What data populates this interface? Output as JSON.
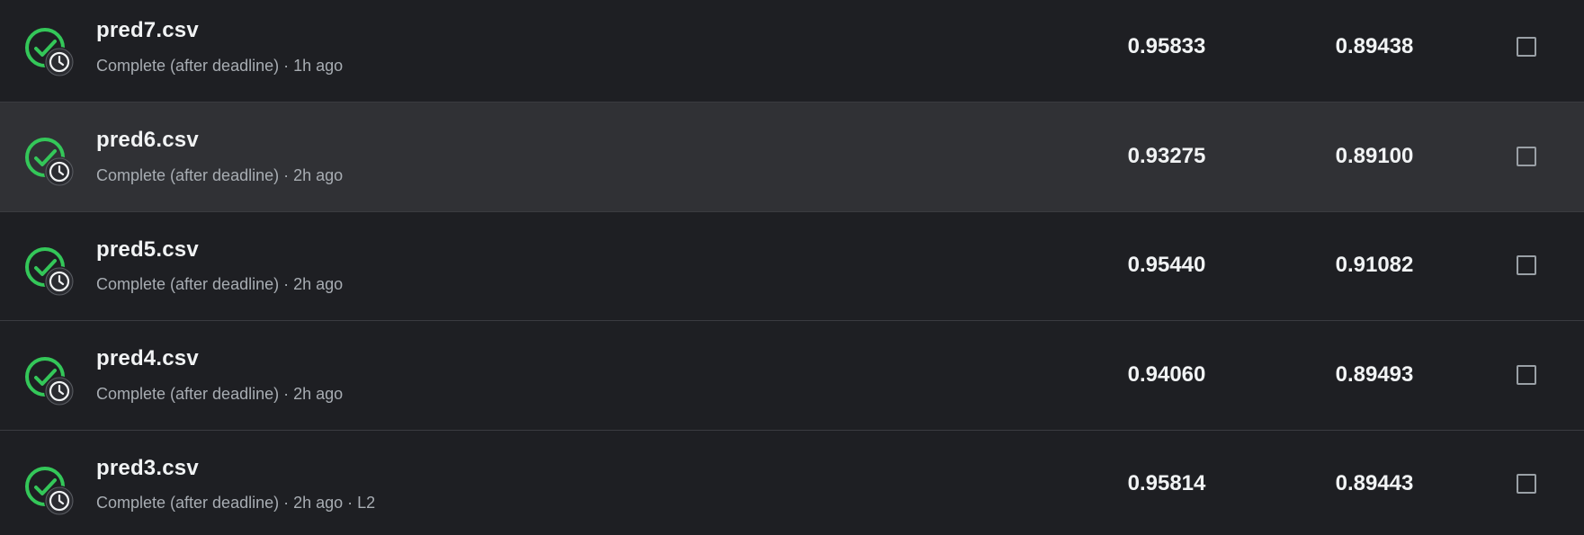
{
  "submissions": [
    {
      "filename": "pred7.csv",
      "status": "Complete (after deadline) · 1h ago",
      "private_score": "0.95833",
      "public_score": "0.89438",
      "selected": false
    },
    {
      "filename": "pred6.csv",
      "status": "Complete (after deadline) · 2h ago",
      "private_score": "0.93275",
      "public_score": "0.89100",
      "selected": false
    },
    {
      "filename": "pred5.csv",
      "status": "Complete (after deadline) · 2h ago",
      "private_score": "0.95440",
      "public_score": "0.91082",
      "selected": false
    },
    {
      "filename": "pred4.csv",
      "status": "Complete (after deadline) · 2h ago",
      "private_score": "0.94060",
      "public_score": "0.89493",
      "selected": false
    },
    {
      "filename": "pred3.csv",
      "status": "Complete (after deadline) · 2h ago · L2",
      "private_score": "0.95814",
      "public_score": "0.89443",
      "selected": false
    }
  ],
  "colors": {
    "success_green": "#34c759",
    "background": "#1e1f23",
    "hover_background": "#303135",
    "text_primary": "#f1f3f4",
    "text_secondary": "#a8adb3"
  },
  "icons": {
    "status": "check-circle-icon",
    "late": "clock-icon"
  }
}
